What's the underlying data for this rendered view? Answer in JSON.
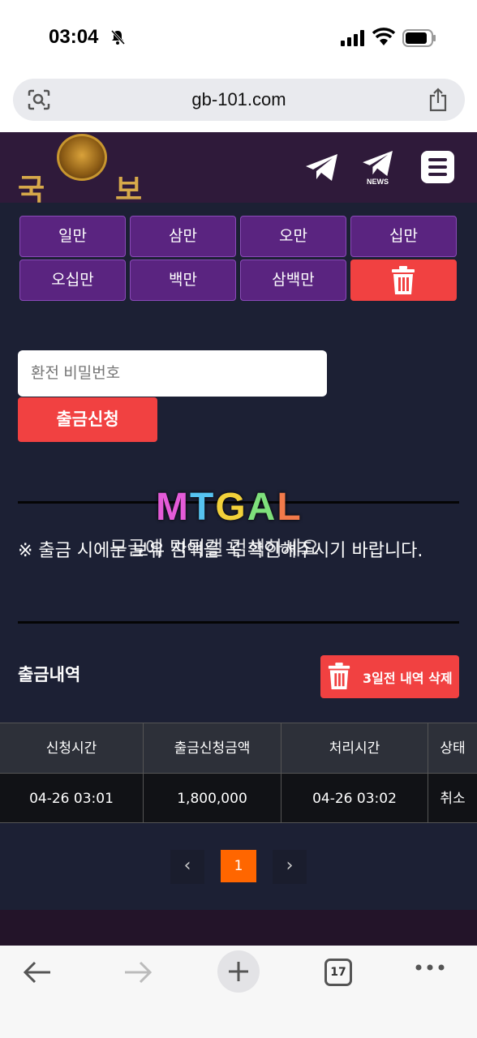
{
  "status_bar": {
    "time": "03:04"
  },
  "browser": {
    "url": "gb-101.com",
    "tab_count": "17"
  },
  "header": {
    "logo_left": "국",
    "logo_right": "보",
    "news_label": "NEWS"
  },
  "amount_buttons": [
    {
      "label": "일만"
    },
    {
      "label": "삼만"
    },
    {
      "label": "오만"
    },
    {
      "label": "십만"
    },
    {
      "label": "오십만"
    },
    {
      "label": "백만"
    },
    {
      "label": "삼백만"
    }
  ],
  "withdraw": {
    "password_placeholder": "환전 비밀번호",
    "submit_label": "출금신청"
  },
  "watermark": {
    "logo": "MTGAL",
    "overlay": "구글에 먹튀갤 검색하세요"
  },
  "notice": "※ 출금 시에는 보유 잔액을 꼭 확인해주시기 바랍니다.",
  "history": {
    "title": "출금내역",
    "delete_label": "3일전 내역 삭제",
    "columns": [
      "신청시간",
      "출금신청금액",
      "처리시간",
      "상태"
    ],
    "rows": [
      {
        "requested": "04-26 03:01",
        "amount": "1,800,000",
        "processed": "04-26 03:02",
        "status": "취소"
      }
    ]
  },
  "pagination": {
    "prev": "‹",
    "current": "1",
    "next": "›"
  },
  "colors": {
    "accent": "#f14141",
    "purple": "#5a2480",
    "bg": "#1c2034",
    "page_active": "#ff6600"
  }
}
